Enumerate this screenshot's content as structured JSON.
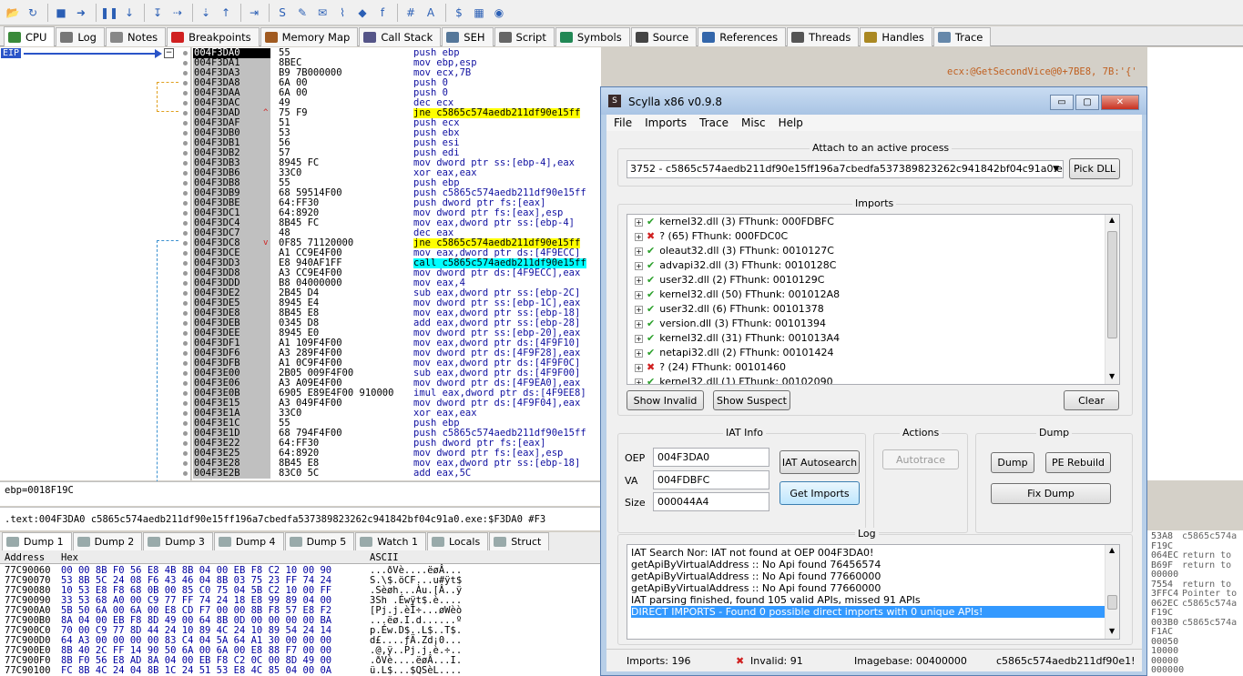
{
  "toolbar": {
    "icons": [
      "open-icon",
      "restart-icon",
      "stop-icon",
      "run-icon",
      "pause-icon",
      "step-into-icon",
      "step-over-icon",
      "trace-into-icon",
      "trace-over-icon",
      "execute-till-return-icon",
      "run-to-user-code-icon",
      "scylla-icon",
      "patch-icon",
      "comment-icon",
      "label-icon",
      "bookmark-icon",
      "function-icon",
      "hash-icon",
      "font-icon",
      "strings-icon",
      "calculator-icon",
      "globe-icon"
    ]
  },
  "tabs": [
    {
      "label": "CPU",
      "color": "#3a8a3a",
      "icon": "cpu-icon"
    },
    {
      "label": "Log",
      "color": "#777777",
      "icon": "log-icon"
    },
    {
      "label": "Notes",
      "color": "#888888",
      "icon": "notes-icon"
    },
    {
      "label": "Breakpoints",
      "color": "#d02020",
      "icon": "breakpoint-icon"
    },
    {
      "label": "Memory Map",
      "color": "#a05a20",
      "icon": "memory-map-icon"
    },
    {
      "label": "Call Stack",
      "color": "#555588",
      "icon": "call-stack-icon"
    },
    {
      "label": "SEH",
      "color": "#557799",
      "icon": "seh-icon"
    },
    {
      "label": "Script",
      "color": "#666666",
      "icon": "script-icon"
    },
    {
      "label": "Symbols",
      "color": "#228855",
      "icon": "symbols-icon"
    },
    {
      "label": "Source",
      "color": "#444444",
      "icon": "source-icon"
    },
    {
      "label": "References",
      "color": "#3366aa",
      "icon": "references-icon"
    },
    {
      "label": "Threads",
      "color": "#555555",
      "icon": "threads-icon"
    },
    {
      "label": "Handles",
      "color": "#aa8822",
      "icon": "handles-icon"
    },
    {
      "label": "Trace",
      "color": "#6688aa",
      "icon": "trace-icon"
    }
  ],
  "disasm": {
    "eip_label": "EIP",
    "rows": [
      {
        "addr": "004F3DA0",
        "bytes": "55",
        "ins": "push ebp",
        "kind": "cur"
      },
      {
        "addr": "004F3DA1",
        "bytes": "8BEC",
        "ins": "mov ebp,esp",
        "kind": ""
      },
      {
        "addr": "004F3DA3",
        "bytes": "B9 7B000000",
        "ins": "mov ecx,7B",
        "kind": ""
      },
      {
        "addr": "004F3DA8",
        "bytes": "6A 00",
        "ins": "push 0",
        "kind": ""
      },
      {
        "addr": "004F3DAA",
        "bytes": "6A 00",
        "ins": "push 0",
        "kind": ""
      },
      {
        "addr": "004F3DAC",
        "bytes": "49",
        "ins": "dec ecx",
        "kind": ""
      },
      {
        "addr": "004F3DAD",
        "bytes": "75 F9",
        "ins": "jne c5865c574aedb211df90e15ff",
        "kind": "jcc",
        "mark": "^"
      },
      {
        "addr": "004F3DAF",
        "bytes": "51",
        "ins": "push ecx",
        "kind": ""
      },
      {
        "addr": "004F3DB0",
        "bytes": "53",
        "ins": "push ebx",
        "kind": ""
      },
      {
        "addr": "004F3DB1",
        "bytes": "56",
        "ins": "push esi",
        "kind": ""
      },
      {
        "addr": "004F3DB2",
        "bytes": "57",
        "ins": "push edi",
        "kind": ""
      },
      {
        "addr": "004F3DB3",
        "bytes": "8945 FC",
        "ins": "mov dword ptr ss:[ebp-4],eax",
        "kind": ""
      },
      {
        "addr": "004F3DB6",
        "bytes": "33C0",
        "ins": "xor eax,eax",
        "kind": ""
      },
      {
        "addr": "004F3DB8",
        "bytes": "55",
        "ins": "push ebp",
        "kind": ""
      },
      {
        "addr": "004F3DB9",
        "bytes": "68 59514F00",
        "ins": "push c5865c574aedb211df90e15ff",
        "kind": ""
      },
      {
        "addr": "004F3DBE",
        "bytes": "64:FF30",
        "ins": "push dword ptr fs:[eax]",
        "kind": ""
      },
      {
        "addr": "004F3DC1",
        "bytes": "64:8920",
        "ins": "mov dword ptr fs:[eax],esp",
        "kind": ""
      },
      {
        "addr": "004F3DC4",
        "bytes": "8B45 FC",
        "ins": "mov eax,dword ptr ss:[ebp-4]",
        "kind": ""
      },
      {
        "addr": "004F3DC7",
        "bytes": "48",
        "ins": "dec eax",
        "kind": ""
      },
      {
        "addr": "004F3DC8",
        "bytes": "0F85 71120000",
        "ins": "jne c5865c574aedb211df90e15ff",
        "kind": "jcc",
        "mark": "v"
      },
      {
        "addr": "004F3DCE",
        "bytes": "A1 CC9E4F00",
        "ins": "mov eax,dword ptr ds:[4F9ECC]",
        "kind": ""
      },
      {
        "addr": "004F3DD3",
        "bytes": "E8 940AF1FF",
        "ins": "call c5865c574aedb211df90e15ff",
        "kind": "call"
      },
      {
        "addr": "004F3DD8",
        "bytes": "A3 CC9E4F00",
        "ins": "mov dword ptr ds:[4F9ECC],eax",
        "kind": ""
      },
      {
        "addr": "004F3DDD",
        "bytes": "B8 04000000",
        "ins": "mov eax,4",
        "kind": ""
      },
      {
        "addr": "004F3DE2",
        "bytes": "2B45 D4",
        "ins": "sub eax,dword ptr ss:[ebp-2C]",
        "kind": ""
      },
      {
        "addr": "004F3DE5",
        "bytes": "8945 E4",
        "ins": "mov dword ptr ss:[ebp-1C],eax",
        "kind": ""
      },
      {
        "addr": "004F3DE8",
        "bytes": "8B45 E8",
        "ins": "mov eax,dword ptr ss:[ebp-18]",
        "kind": ""
      },
      {
        "addr": "004F3DEB",
        "bytes": "0345 D8",
        "ins": "add eax,dword ptr ss:[ebp-28]",
        "kind": ""
      },
      {
        "addr": "004F3DEE",
        "bytes": "8945 E0",
        "ins": "mov dword ptr ss:[ebp-20],eax",
        "kind": ""
      },
      {
        "addr": "004F3DF1",
        "bytes": "A1 109F4F00",
        "ins": "mov eax,dword ptr ds:[4F9F10]",
        "kind": ""
      },
      {
        "addr": "004F3DF6",
        "bytes": "A3 289F4F00",
        "ins": "mov dword ptr ds:[4F9F28],eax",
        "kind": ""
      },
      {
        "addr": "004F3DFB",
        "bytes": "A1 0C9F4F00",
        "ins": "mov eax,dword ptr ds:[4F9F0C]",
        "kind": ""
      },
      {
        "addr": "004F3E00",
        "bytes": "2B05 009F4F00",
        "ins": "sub eax,dword ptr ds:[4F9F00]",
        "kind": ""
      },
      {
        "addr": "004F3E06",
        "bytes": "A3 A09E4F00",
        "ins": "mov dword ptr ds:[4F9EA0],eax",
        "kind": ""
      },
      {
        "addr": "004F3E0B",
        "bytes": "6905 E89E4F00 910000",
        "ins": "imul eax,dword ptr ds:[4F9EE8]",
        "kind": ""
      },
      {
        "addr": "004F3E15",
        "bytes": "A3 049F4F00",
        "ins": "mov dword ptr ds:[4F9F04],eax",
        "kind": ""
      },
      {
        "addr": "004F3E1A",
        "bytes": "33C0",
        "ins": "xor eax,eax",
        "kind": ""
      },
      {
        "addr": "004F3E1C",
        "bytes": "55",
        "ins": "push ebp",
        "kind": ""
      },
      {
        "addr": "004F3E1D",
        "bytes": "68 794F4F00",
        "ins": "push c5865c574aedb211df90e15ff",
        "kind": ""
      },
      {
        "addr": "004F3E22",
        "bytes": "64:FF30",
        "ins": "push dword ptr fs:[eax]",
        "kind": ""
      },
      {
        "addr": "004F3E25",
        "bytes": "64:8920",
        "ins": "mov dword ptr fs:[eax],esp",
        "kind": ""
      },
      {
        "addr": "004F3E28",
        "bytes": "8B45 E8",
        "ins": "mov eax,dword ptr ss:[ebp-18]",
        "kind": ""
      },
      {
        "addr": "004F3E2B",
        "bytes": "83C0 5C",
        "ins": "add eax,5C",
        "kind": ""
      }
    ],
    "comment": "ecx:@GetSecondVice@0+7BE8, 7B:'{'"
  },
  "info": {
    "line1": "ebp=0018F19C",
    "line2": ".text:004F3DA0 c5865c574aedb211df90e15ff196a7cbedfa537389823262c941842bf04c91a0.exe:$F3DA0 #F3"
  },
  "dump_tabs": [
    {
      "label": "Dump 1"
    },
    {
      "label": "Dump 2"
    },
    {
      "label": "Dump 3"
    },
    {
      "label": "Dump 4"
    },
    {
      "label": "Dump 5"
    },
    {
      "label": "Watch 1"
    },
    {
      "label": "Locals"
    },
    {
      "label": "Struct"
    }
  ],
  "dump": {
    "headers": {
      "address": "Address",
      "hex": "Hex",
      "ascii": "ASCII"
    },
    "rows": [
      {
        "addr": "77C90060",
        "hex": "00 00 8B F0 56 E8 4B 8B 04 00 EB F8 C2 10 00 90",
        "ascii": "...ðVè....ëøÂ..."
      },
      {
        "addr": "77C90070",
        "hex": "53 8B 5C 24 08 F6 43 46 04 8B 03 75 23 FF 74 24",
        "ascii": "S.\\$.öCF...u#ÿt$"
      },
      {
        "addr": "77C90080",
        "hex": "10 53 E8 F8 68 0B 00 85 C0 75 04 5B C2 10 00 FF",
        "ascii": ".Sèøh...Àu.[Â..ÿ"
      },
      {
        "addr": "77C90090",
        "hex": "33 53 68 A0 00 C9 77 FF 74 24 18 E8 99 89 04 00",
        "ascii": "3Sh .Éwÿt$.è...."
      },
      {
        "addr": "77C900A0",
        "hex": "5B 50 6A 00 6A 00 E8 CD F7 00 00 8B F8 57 E8 F2",
        "ascii": "[Pj.j.èÍ÷...øWèò"
      },
      {
        "addr": "77C900B0",
        "hex": "8A 04 00 EB F8 8D 49 00 64 8B 0D 00 00 00 00 BA",
        "ascii": "...ëø.I.d......º"
      },
      {
        "addr": "77C900C0",
        "hex": "70 00 C9 77 8D 44 24 10 89 4C 24 10 89 54 24 14",
        "ascii": "p.Éw.D$..L$..T$."
      },
      {
        "addr": "77C900D0",
        "hex": "64 A3 00 00 00 00 83 C4 04 5A 64 A1 30 00 00 00",
        "ascii": "d£....ƒÄ.Zd¡0..."
      },
      {
        "addr": "77C900E0",
        "hex": "8B 40 2C FF 14 90 50 6A 00 6A 00 E8 88 F7 00 00",
        "ascii": ".@,ÿ..Pj.j.è.÷.."
      },
      {
        "addr": "77C900F0",
        "hex": "8B F0 56 E8 AD 8A 04 00 EB F8 C2 0C 00 8D 49 00",
        "ascii": ".ðVè....ëøÂ...I."
      },
      {
        "addr": "77C90100",
        "hex": "FC 8B 4C 24 04 8B 1C 24 51 53 E8 4C 85 04 00 0A",
        "ascii": "ü.L$...$QSèL...."
      }
    ]
  },
  "stack_right": [
    {
      "l": "53A8",
      "r": "c5865c574a"
    },
    {
      "l": "F19C",
      "r": ""
    },
    {
      "l": "064EC",
      "r": "return to"
    },
    {
      "l": "B69F",
      "r": "return to"
    },
    {
      "l": "00000",
      "r": ""
    },
    {
      "l": "7554",
      "r": "return to"
    },
    {
      "l": "3FFC4",
      "r": "Pointer to"
    },
    {
      "l": "062EC",
      "r": "c5865c574a"
    },
    {
      "l": "F19C",
      "r": ""
    },
    {
      "l": "003B0",
      "r": "c5865c574a"
    },
    {
      "l": "F1AC",
      "r": ""
    },
    {
      "l": "00050",
      "r": ""
    },
    {
      "l": "10000",
      "r": ""
    },
    {
      "l": "00000",
      "r": ""
    },
    {
      "l": "000000",
      "r": ""
    }
  ],
  "scylla": {
    "title": "Scylla x86 v0.9.8",
    "win_buttons": {
      "min": "▭",
      "max": "▢",
      "close": "✕"
    },
    "menu": [
      "File",
      "Imports",
      "Trace",
      "Misc",
      "Help"
    ],
    "attach_title": "Attach to an active process",
    "process": "3752 - c5865c574aedb211df90e15ff196a7cbedfa537389823262c941842bf04c91a0.exe - C:\\U",
    "pick_dll": "Pick DLL",
    "imports_title": "Imports",
    "imports": [
      {
        "text": "kernel32.dll (3) FThunk: 000FDBFC",
        "ok": true
      },
      {
        "text": "? (65) FThunk: 000FDC0C",
        "ok": false
      },
      {
        "text": "oleaut32.dll (3) FThunk: 0010127C",
        "ok": true
      },
      {
        "text": "advapi32.dll (3) FThunk: 0010128C",
        "ok": true
      },
      {
        "text": "user32.dll (2) FThunk: 0010129C",
        "ok": true
      },
      {
        "text": "kernel32.dll (50) FThunk: 001012A8",
        "ok": true
      },
      {
        "text": "user32.dll (6) FThunk: 00101378",
        "ok": true
      },
      {
        "text": "version.dll (3) FThunk: 00101394",
        "ok": true
      },
      {
        "text": "kernel32.dll (31) FThunk: 001013A4",
        "ok": true
      },
      {
        "text": "netapi32.dll (2) FThunk: 00101424",
        "ok": true
      },
      {
        "text": "? (24) FThunk: 00101460",
        "ok": false
      },
      {
        "text": "kernel32.dll (1) FThunk: 00102090",
        "ok": true
      }
    ],
    "show_invalid": "Show Invalid",
    "show_suspect": "Show Suspect",
    "clear": "Clear",
    "iat_title": "IAT Info",
    "oep_label": "OEP",
    "oep": "004F3DA0",
    "va_label": "VA",
    "va": "004FDBFC",
    "size_label": "Size",
    "size": "000044A4",
    "iat_autosearch": "IAT Autosearch",
    "get_imports": "Get Imports",
    "actions_title": "Actions",
    "autotrace": "Autotrace",
    "dump_title": "Dump",
    "dump": "Dump",
    "pe_rebuild": "PE Rebuild",
    "fix_dump": "Fix Dump",
    "log_title": "Log",
    "log": [
      {
        "text": "IAT Search Nor: IAT not found at OEP 004F3DA0!",
        "sel": false
      },
      {
        "text": "getApiByVirtualAddress :: No Api found 76456574",
        "sel": false
      },
      {
        "text": "getApiByVirtualAddress :: No Api found 77660000",
        "sel": false
      },
      {
        "text": "getApiByVirtualAddress :: No Api found 77660000",
        "sel": false
      },
      {
        "text": "IAT parsing finished, found 105 valid APIs, missed 91 APIs",
        "sel": false
      },
      {
        "text": "DIRECT IMPORTS - Found 0 possible direct imports with 0 unique APIs!",
        "sel": true
      }
    ],
    "status": {
      "imports": "Imports: 196",
      "invalid": "Invalid: 91",
      "imagebase": "Imagebase: 00400000",
      "module": "c5865c574aedb211df90e1!"
    }
  }
}
